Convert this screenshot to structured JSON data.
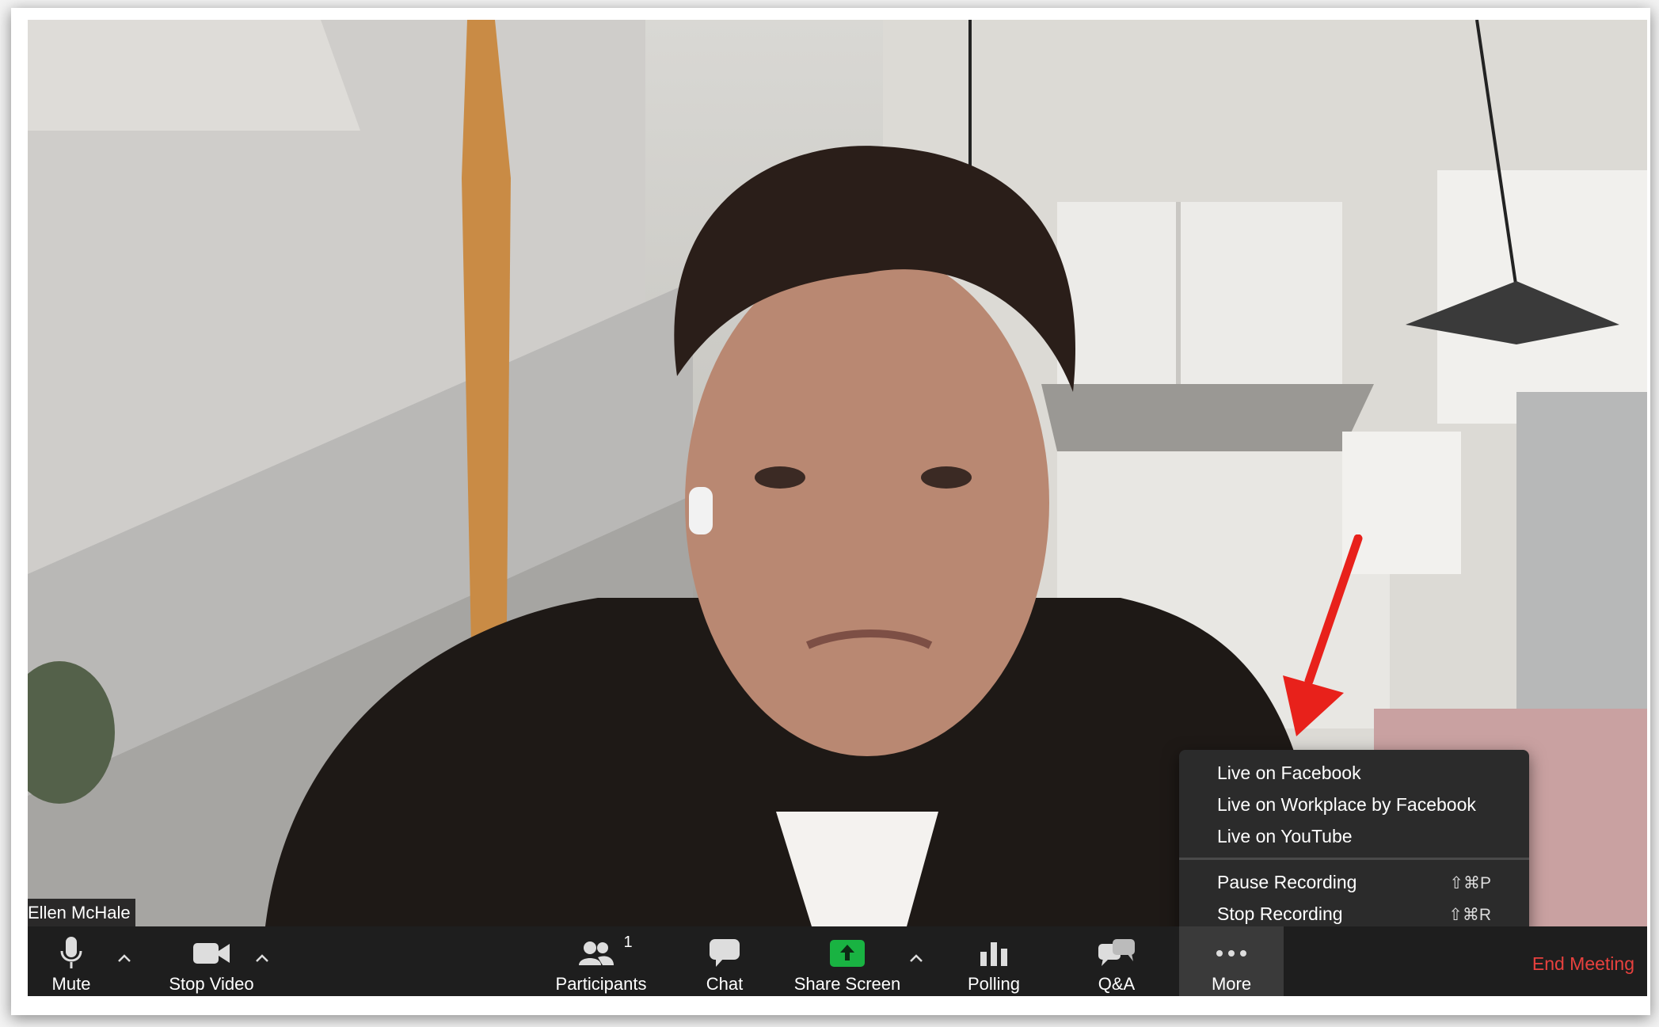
{
  "participant": {
    "name": "Ellen McHale"
  },
  "toolbar": {
    "mute_label": "Mute",
    "stop_video_label": "Stop Video",
    "participants_label": "Participants",
    "participants_count": "1",
    "chat_label": "Chat",
    "share_screen_label": "Share Screen",
    "polling_label": "Polling",
    "qa_label": "Q&A",
    "more_label": "More",
    "end_meeting_label": "End Meeting"
  },
  "more_menu": {
    "items": [
      {
        "label": "Live on Facebook"
      },
      {
        "label": "Live on Workplace by Facebook"
      },
      {
        "label": "Live on YouTube"
      },
      {
        "label": "Pause Recording",
        "shortcut": "⇧⌘P"
      },
      {
        "label": "Stop Recording",
        "shortcut": "⇧⌘R"
      }
    ]
  },
  "colors": {
    "end_meeting": "#e8413e",
    "share_screen_green": "#19b342",
    "toolbar_bg": "#1e1e1e",
    "annotation_arrow": "#e8211b"
  },
  "icons": [
    "microphone-icon",
    "caret-up-icon",
    "video-camera-icon",
    "participants-icon",
    "chat-bubble-icon",
    "share-screen-icon",
    "bar-chart-icon",
    "qa-bubbles-icon",
    "ellipsis-icon"
  ]
}
